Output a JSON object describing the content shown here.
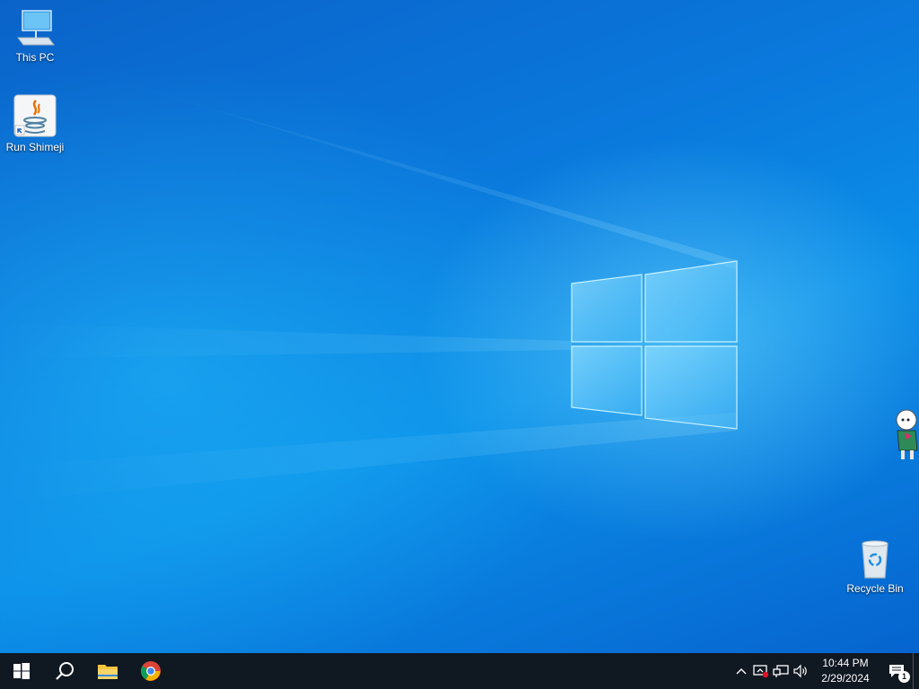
{
  "desktop": {
    "icons": [
      {
        "label": "This PC",
        "icon": "computer-icon"
      },
      {
        "label": "Run Shimeji",
        "icon": "java-icon"
      },
      {
        "label": "Recycle Bin",
        "icon": "recycle-bin-icon"
      }
    ]
  },
  "taskbar": {
    "buttons": [
      {
        "name": "start-button",
        "icon": "windows-logo-icon"
      },
      {
        "name": "search-button",
        "icon": "search-icon"
      },
      {
        "name": "file-explorer-button",
        "icon": "folder-icon"
      },
      {
        "name": "chrome-button",
        "icon": "chrome-icon"
      }
    ]
  },
  "tray": {
    "icons": [
      "chevron-up-icon",
      "security-alert-icon",
      "network-icon",
      "volume-icon"
    ],
    "time": "10:44 PM",
    "date": "2/29/2024",
    "notifications_count": "1"
  },
  "colors": {
    "taskbar": "#101822",
    "wallpaper_accent": "#0a78dc"
  }
}
